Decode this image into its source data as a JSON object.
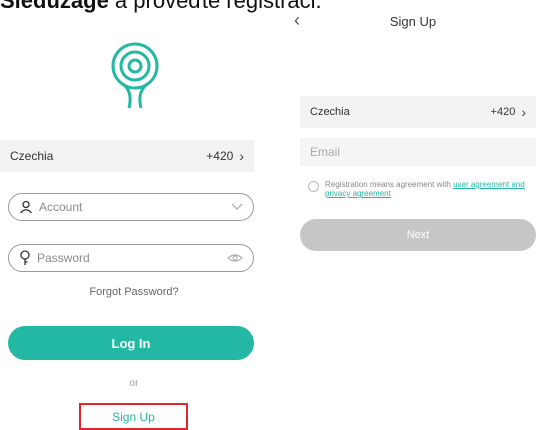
{
  "caption": {
    "bold": "Sledužage",
    "rest": " a proveďte registraci."
  },
  "login": {
    "country": "Czechia",
    "country_code": "+420",
    "account_placeholder": "Account",
    "password_placeholder": "Password",
    "forgot_label": "Forgot Password?",
    "login_label": "Log In",
    "or_label": "or",
    "signup_label": "Sign Up"
  },
  "signup": {
    "title": "Sign Up",
    "country": "Czechia",
    "country_code": "+420",
    "email_placeholder": "Email",
    "agreement_text": "Registration means agreement with ",
    "agreement_link": "user agreement and privacy agreement",
    "next_label": "Next"
  },
  "colors": {
    "accent": "#22b8a3",
    "highlight_box": "#e1262c",
    "disabled_button": "#c6c6c6"
  },
  "icons": {
    "logo": "camera-pin-logo",
    "account": "user-icon",
    "password": "keyhole-icon",
    "eye": "eye-icon",
    "dropdown": "chevron-down-icon",
    "back": "chevron-left-icon"
  }
}
